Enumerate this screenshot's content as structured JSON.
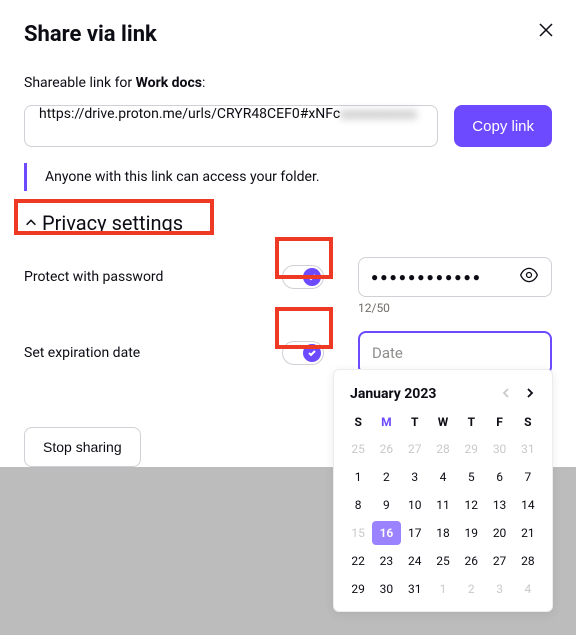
{
  "title": "Share via link",
  "subtitle_prefix": "Shareable link for ",
  "subtitle_folder": "Work docs",
  "subtitle_suffix": ":",
  "link_visible": "https://drive.proton.me/urls/CRYR48CEF0#xNFc",
  "copy_btn": "Copy link",
  "info": "Anyone with this link can access your folder.",
  "privacy_header": "Privacy settings",
  "pw_label": "Protect with password",
  "pw_dots": "●●●●●●●●●●●●",
  "pw_counter": "12/50",
  "exp_label": "Set expiration date",
  "date_placeholder": "Date",
  "stop_btn": "Stop sharing",
  "calendar": {
    "title": "January 2023",
    "dow": [
      "S",
      "M",
      "T",
      "W",
      "T",
      "F",
      "S"
    ],
    "dow_today_index": 1,
    "weeks": [
      [
        {
          "d": 25,
          "m": true
        },
        {
          "d": 26,
          "m": true
        },
        {
          "d": 27,
          "m": true
        },
        {
          "d": 28,
          "m": true
        },
        {
          "d": 29,
          "m": true
        },
        {
          "d": 30,
          "m": true
        },
        {
          "d": 31,
          "m": true
        }
      ],
      [
        {
          "d": 1
        },
        {
          "d": 2
        },
        {
          "d": 3
        },
        {
          "d": 4
        },
        {
          "d": 5
        },
        {
          "d": 6
        },
        {
          "d": 7
        }
      ],
      [
        {
          "d": 8
        },
        {
          "d": 9
        },
        {
          "d": 10
        },
        {
          "d": 11
        },
        {
          "d": 12
        },
        {
          "d": 13
        },
        {
          "d": 14
        }
      ],
      [
        {
          "d": 15,
          "m": true
        },
        {
          "d": 16,
          "sel": true
        },
        {
          "d": 17
        },
        {
          "d": 18
        },
        {
          "d": 19
        },
        {
          "d": 20
        },
        {
          "d": 21
        }
      ],
      [
        {
          "d": 22
        },
        {
          "d": 23
        },
        {
          "d": 24
        },
        {
          "d": 25
        },
        {
          "d": 26
        },
        {
          "d": 27
        },
        {
          "d": 28
        }
      ],
      [
        {
          "d": 29
        },
        {
          "d": 30
        },
        {
          "d": 31
        },
        {
          "d": 1,
          "m": true
        },
        {
          "d": 2,
          "m": true
        },
        {
          "d": 3,
          "m": true
        },
        {
          "d": 4,
          "m": true
        }
      ]
    ]
  }
}
